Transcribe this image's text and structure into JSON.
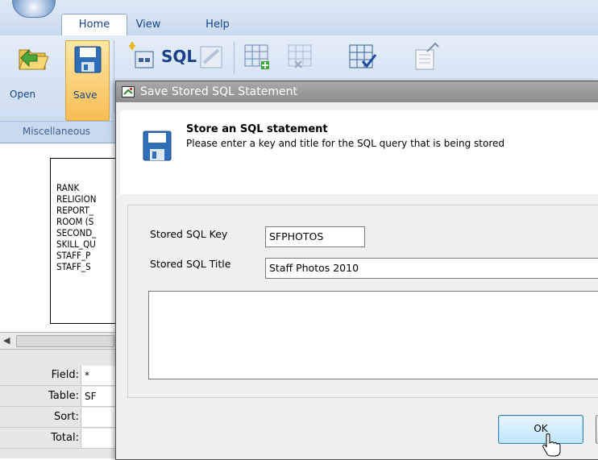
{
  "ribbon": {
    "tabs": [
      {
        "label": "Home"
      },
      {
        "label": "View"
      },
      {
        "label": "Help"
      }
    ],
    "open_label": "Open",
    "save_label": "Save",
    "sql_label": "SQL",
    "group_label": "Miscellaneous"
  },
  "table_list": [
    "RANK",
    "RELIGION",
    "REPORT_",
    "ROOM (S",
    "SECOND_",
    "SKILL_QU",
    "STAFF_P",
    "STAFF_S"
  ],
  "grid": {
    "rows": [
      {
        "label": "Field:",
        "value": "*"
      },
      {
        "label": "Table:",
        "value": "SF"
      },
      {
        "label": "Sort:",
        "value": ""
      },
      {
        "label": "Total:",
        "value": ""
      }
    ]
  },
  "dialog": {
    "title": "Save Stored SQL Statement",
    "header_title": "Store an SQL statement",
    "header_subtitle": "Please enter a key and title for the SQL query that is being stored",
    "key_label": "Stored SQL Key",
    "key_value": "SFPHOTOS",
    "title_label": "Stored SQL Title",
    "title_value": "Staff Photos 2010",
    "description_value": "",
    "ok_label": "OK"
  }
}
